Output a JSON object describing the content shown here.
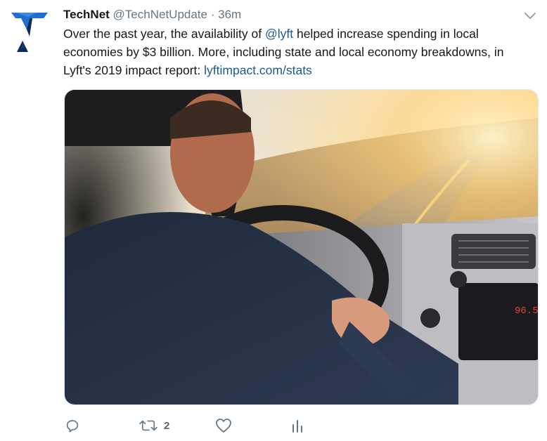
{
  "tweet": {
    "author_name": "TechNet",
    "author_handle": "@TechNetUpdate",
    "separator": "·",
    "timestamp": "36m",
    "text_part1": "Over the past year, the availability of ",
    "mention": "@lyft",
    "text_part2": " helped increase spending in local economies by $3 billion. More, including state and local economy breakdowns, in Lyft's 2019 impact report: ",
    "link": "lyftimpact.com/stats",
    "media": {
      "description_icon": "photo-driver-steering-wheel",
      "radio_display": "96.5"
    }
  },
  "actions": {
    "reply_count": "",
    "retweet_count": "2",
    "like_count": ""
  },
  "colors": {
    "link": "#1b5a8b",
    "secondary_text": "#657786",
    "avatar_blue": "#1f6fd1",
    "avatar_navy": "#0e2a5a"
  }
}
